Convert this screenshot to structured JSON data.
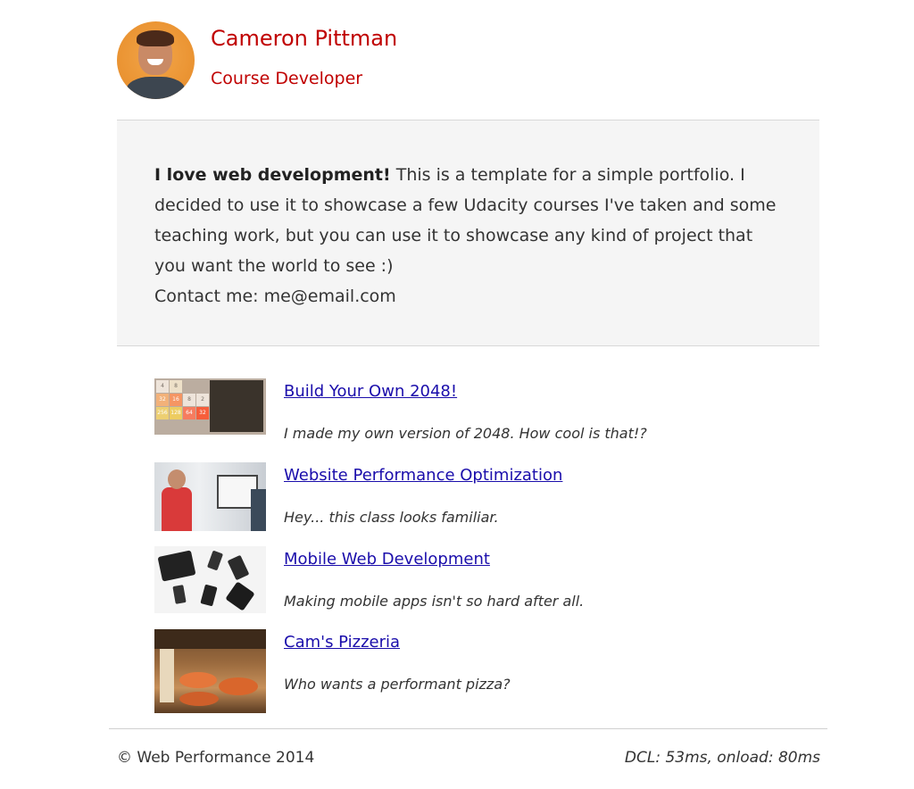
{
  "header": {
    "name": "Cameron Pittman",
    "role": "Course Developer"
  },
  "intro": {
    "bold": "I love web development!",
    "text": " This is a template for a simple portfolio. I decided to use it to showcase a few Udacity courses I've taken and some teaching work, but you can use it to showcase any kind of project that you want the world to see :)",
    "contact": "Contact me: me@email.com"
  },
  "projects": [
    {
      "title": "Build Your Own 2048!",
      "description": "I made my own version of 2048. How cool is that!?",
      "thumb_icon": "2048-game-thumbnail"
    },
    {
      "title": "Website Performance Optimization",
      "description": "Hey... this class looks familiar.",
      "thumb_icon": "classroom-photo-thumbnail"
    },
    {
      "title": "Mobile Web Development",
      "description": "Making mobile apps isn't so hard after all.",
      "thumb_icon": "mobile-devices-thumbnail"
    },
    {
      "title": "Cam's Pizzeria",
      "description": "Who wants a performant pizza?",
      "thumb_icon": "pizzeria-photo-thumbnail"
    }
  ],
  "footer": {
    "copyright": "© Web Performance 2014",
    "perf": "DCL: 53ms, onload: 80ms"
  },
  "colors": {
    "accent": "#c00000",
    "link": "#1a0dab",
    "intro_bg": "#f5f5f5"
  }
}
